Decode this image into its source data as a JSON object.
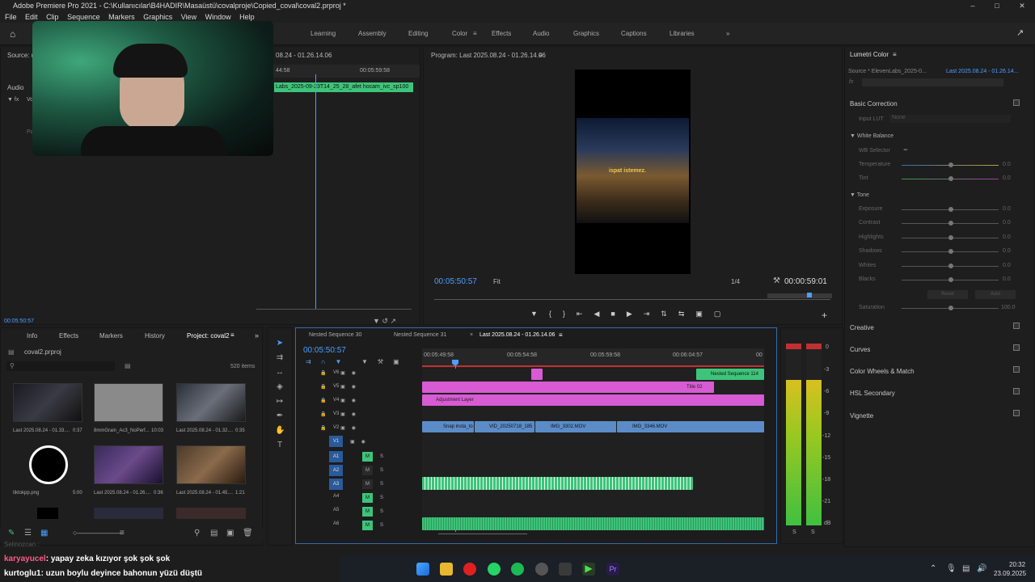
{
  "window": {
    "title": "Adobe Premiere Pro 2021 - C:\\Kullanıcılar\\B4HADIR\\Masaüstü\\covalproje\\Copied_coval\\coval2.prproj *"
  },
  "menu": [
    "File",
    "Edit",
    "Clip",
    "Sequence",
    "Markers",
    "Graphics",
    "View",
    "Window",
    "Help"
  ],
  "workspaces": [
    "Learning",
    "Assembly",
    "Editing",
    "Color",
    "Effects",
    "Audio",
    "Graphics",
    "Captions",
    "Libraries"
  ],
  "active_workspace": "Color",
  "source_panel": {
    "label": "Source: (n",
    "audio": "Audio",
    "items": [
      "Vol",
      "Pa"
    ],
    "ruler": [
      "44:58",
      "00:05:59:58"
    ],
    "header_time": "08.24 - 01.26.14.06",
    "clip_label": "Labs_2025-09-23T14_25_28_afet hocam_ivc_sp100",
    "timecode": "00:05:50:57"
  },
  "program_monitor": {
    "title": "Program: Last 2025.08.24 - 01.26.14.06",
    "timecode": "00:05:50:57",
    "fit": "Fit",
    "resolution": "1/4",
    "duration": "00:00:59:01",
    "caption": "ispat istemez."
  },
  "lumetri": {
    "title": "Lumetri Color",
    "source": "Source * ElevenLabs_2025-0...",
    "target": "Last 2025.08.24 - 01.26.14...",
    "fx": "fx",
    "sections": [
      "Basic Correction",
      "Creative",
      "Curves",
      "Color Wheels & Match",
      "HSL Secondary",
      "Vignette"
    ],
    "input_lut": "Input LUT",
    "input_lut_value": "None",
    "white_balance": "White Balance",
    "wb_selector": "WB Selector",
    "wb_sliders": [
      {
        "name": "Temperature",
        "value": "0.0"
      },
      {
        "name": "Tint",
        "value": "0.0"
      }
    ],
    "tone": "Tone",
    "tone_sliders": [
      {
        "name": "Exposure",
        "value": "0.0"
      },
      {
        "name": "Contrast",
        "value": "0.0"
      },
      {
        "name": "Highlights",
        "value": "0.0"
      },
      {
        "name": "Shadows",
        "value": "0.0"
      },
      {
        "name": "Whites",
        "value": "0.0"
      },
      {
        "name": "Blacks",
        "value": "0.0"
      }
    ],
    "reset": "Reset",
    "auto": "Auto",
    "saturation": {
      "name": "Saturation",
      "value": "100.0"
    }
  },
  "project_panel": {
    "tabs": [
      "Info",
      "Effects",
      "Markers",
      "History",
      "Project: coval2"
    ],
    "file": "coval2.prproj",
    "count": "520 items",
    "items": [
      {
        "name": "Last 2025.08.24 - 01.33....",
        "dur": "0:37"
      },
      {
        "name": "8mmGrain_Ac3_NoPerf...",
        "dur": "10:03"
      },
      {
        "name": "Last 2025.08.24 - 01.32....",
        "dur": "0:35"
      },
      {
        "name": "tiktokpp.png",
        "dur": "5:00"
      },
      {
        "name": "Last 2025.08.24 - 01.26....",
        "dur": "0:36"
      },
      {
        "name": "Last 2025.08.24 - 01.45....",
        "dur": "1:21"
      }
    ]
  },
  "timeline": {
    "tabs": [
      "Nested Sequence 30",
      "Nested Sequence 31",
      "Last 2025.08.24 - 01.26.14.06"
    ],
    "timecode": "00:05:50:57",
    "ruler": [
      "00:05:49:58",
      "00:05:54:58",
      "00:05:59:58",
      "00:06:04:57",
      "00"
    ],
    "tracks": [
      "V6",
      "V5",
      "V4",
      "V3",
      "V2",
      "V1",
      "A1",
      "A2",
      "A3",
      "A4",
      "A5",
      "A6"
    ],
    "clips": {
      "nested": "Nested Sequence 114",
      "title": "Title 02",
      "adjustment": "Adjustment Layer",
      "v2": [
        "Snap insta_to",
        "VID_20250718_185",
        "IMG_3302.MOV",
        "IMG_3346.MOV"
      ]
    },
    "m": "M",
    "s": "S"
  },
  "meter_scale": [
    "0",
    "-3",
    "-6",
    "-9",
    "-12",
    "-15",
    "-18",
    "-21",
    "dB"
  ],
  "meter_labels": [
    "S",
    "S"
  ],
  "chat": [
    {
      "user": "karyayucel",
      "msg": ": yapay zeka kızıyor şok şok şok"
    },
    {
      "user": "kurtoglu1",
      "msg": ": uzun boylu deyince bahonun yüzü düştü"
    }
  ],
  "chat_ghost": "Selinozcan :",
  "taskbar": {
    "time": "20:32",
    "date": "23.09.2025"
  },
  "colors": {
    "accent": "#4b9fff",
    "pink_clip": "#d75bd3",
    "blue_clip": "#5b8cc8",
    "green_clip": "#3ec47a"
  }
}
